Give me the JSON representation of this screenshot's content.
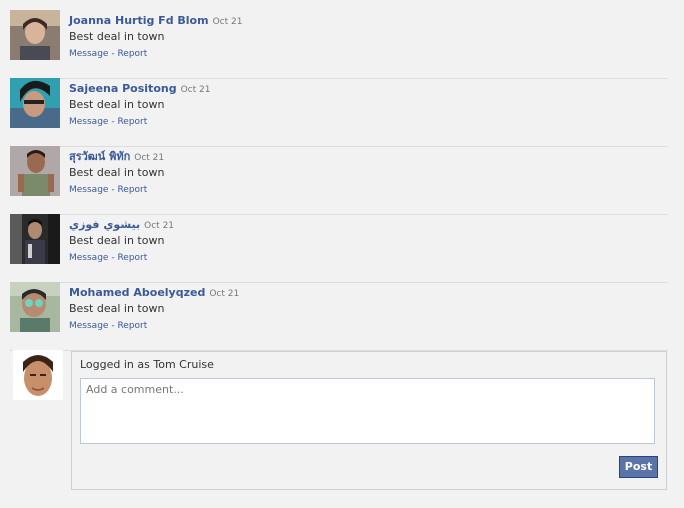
{
  "comments": [
    {
      "name": "Joanna Hurtig Fd Blom",
      "date": "Oct 21",
      "text": "Best deal in town",
      "message": "Message",
      "sep": " - ",
      "report": "Report"
    },
    {
      "name": "Sajeena Positong",
      "date": "Oct 21",
      "text": "Best deal in town",
      "message": "Message",
      "sep": " - ",
      "report": "Report"
    },
    {
      "name": "สุรวัฒน์ พิทัก",
      "date": "Oct 21",
      "text": "Best deal in town",
      "message": "Message",
      "sep": " - ",
      "report": "Report"
    },
    {
      "name": "بيشوي فوزي",
      "date": "Oct 21",
      "text": "Best deal in town",
      "message": "Message",
      "sep": " - ",
      "report": "Report"
    },
    {
      "name": "Mohamed Aboelyqzed",
      "date": "Oct 21",
      "text": "Best deal in town",
      "message": "Message",
      "sep": " - ",
      "report": "Report"
    }
  ],
  "composer": {
    "logged_in_text": "Logged in as Tom Cruise",
    "placeholder": "Add a comment...",
    "post_label": "Post"
  },
  "colors": {
    "link": "#3b5998",
    "background": "#f2f2f2",
    "post_button": "#5b74a8"
  }
}
